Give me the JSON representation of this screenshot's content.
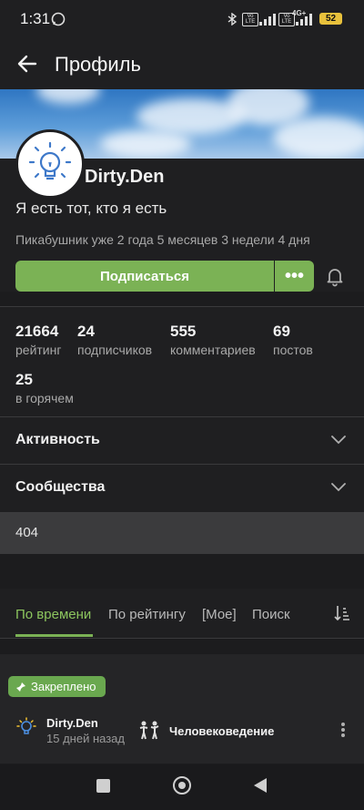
{
  "status_bar": {
    "time": "1:31",
    "battery": "52"
  },
  "header": {
    "title": "Профиль"
  },
  "profile": {
    "username": "Dirty.Den",
    "bio": "Я есть тот, кто я есть",
    "member_since": "Пикабушник уже 2 года 5 месяцев 3 недели 4 дня",
    "subscribe_label": "Подписаться",
    "more_label": "•••"
  },
  "stats": [
    {
      "value": "21664",
      "label": "рейтинг"
    },
    {
      "value": "24",
      "label": "подписчиков"
    },
    {
      "value": "555",
      "label": "комментариев"
    },
    {
      "value": "69",
      "label": "постов"
    },
    {
      "value": "25",
      "label": "в горячем"
    }
  ],
  "sections": {
    "activity": "Активность",
    "communities": "Сообщества"
  },
  "error_block": {
    "text": "404"
  },
  "tabs": [
    {
      "label": "По времени",
      "active": true
    },
    {
      "label": "По рейтингу",
      "active": false
    },
    {
      "label": "[Мое]",
      "active": false
    },
    {
      "label": "Поиск",
      "active": false
    }
  ],
  "post": {
    "pinned_label": "Закреплено",
    "author": "Dirty.Den",
    "time_ago": "15 дней назад",
    "community": "Человековедение"
  },
  "colors": {
    "accent": "#7bb255",
    "background": "#1c1c1e",
    "surface": "#1f1f21"
  }
}
